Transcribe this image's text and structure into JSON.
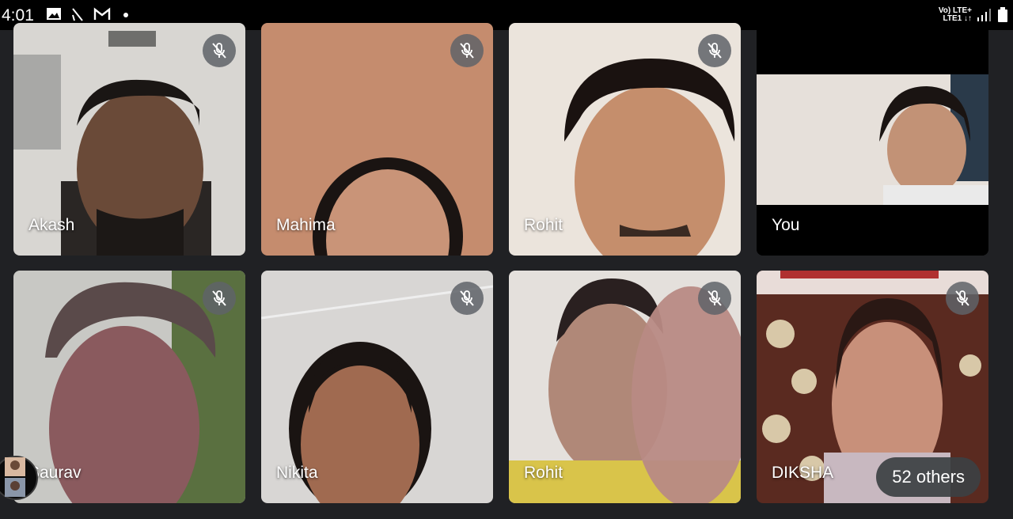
{
  "status_bar": {
    "time": "4:01",
    "network_line1": "Vo) LTE+",
    "network_line2": "LTE1 ↓↑",
    "icons": [
      "image-icon",
      "signal-slash-icon",
      "gmail-icon",
      "dot-icon",
      "signal-bars-icon",
      "battery-icon"
    ]
  },
  "tiles": [
    {
      "name": "Akash",
      "muted": true
    },
    {
      "name": "Mahima",
      "muted": true
    },
    {
      "name": "Rohit",
      "muted": true
    },
    {
      "name": "You",
      "muted": false
    },
    {
      "name": "Saurav",
      "muted": true
    },
    {
      "name": "Nikita",
      "muted": true
    },
    {
      "name": "Rohit",
      "muted": true
    },
    {
      "name": "DIKSHA",
      "muted": true
    }
  ],
  "others_label": "52 others",
  "colors": {
    "background": "#202124",
    "mic_badge": "#5f6368"
  }
}
